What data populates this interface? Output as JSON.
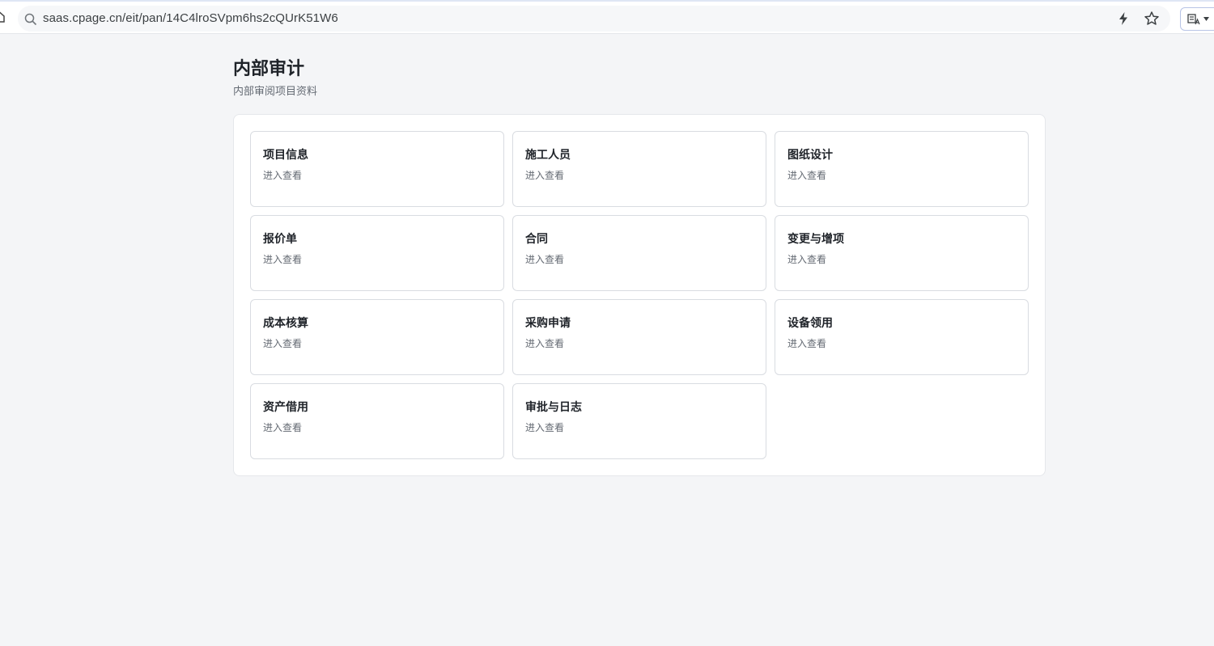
{
  "browser": {
    "url": "saas.cpage.cn/eit/pan/14C4lroSVpm6hs2cQUrK51W6",
    "icons": [
      "home-icon",
      "search-icon",
      "bolt-icon",
      "star-icon",
      "reader-mode-icon",
      "chevron-down-icon"
    ]
  },
  "page": {
    "title": "内部审计",
    "subtitle": "内部审阅项目资料"
  },
  "cards": [
    {
      "title": "项目信息",
      "link": "进入查看"
    },
    {
      "title": "施工人员",
      "link": "进入查看"
    },
    {
      "title": "图纸设计",
      "link": "进入查看"
    },
    {
      "title": "报价单",
      "link": "进入查看"
    },
    {
      "title": "合同",
      "link": "进入查看"
    },
    {
      "title": "变更与增项",
      "link": "进入查看"
    },
    {
      "title": "成本核算",
      "link": "进入查看"
    },
    {
      "title": "采购申请",
      "link": "进入查看"
    },
    {
      "title": "设备领用",
      "link": "进入查看"
    },
    {
      "title": "资产借用",
      "link": "进入查看"
    },
    {
      "title": "审批与日志",
      "link": "进入查看"
    }
  ],
  "colors": {
    "background": "#f4f5f7",
    "panel": "#ffffff",
    "card_border": "#d9dce1",
    "title_text": "#1f2329",
    "muted_text": "#646a73"
  }
}
